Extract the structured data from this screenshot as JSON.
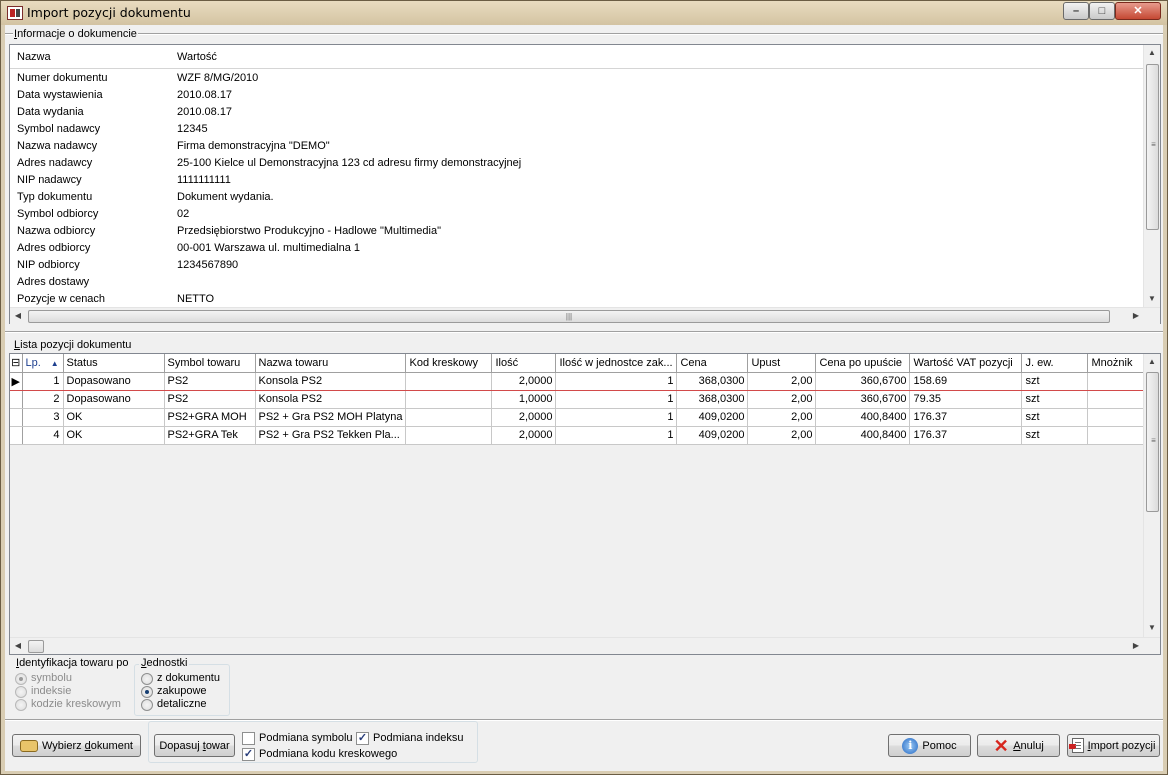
{
  "window": {
    "title": "Import pozycji dokumentu"
  },
  "info": {
    "section_label_prefix": "I",
    "section_label_rest": "nformacje o dokumencie",
    "col_name": "Nazwa",
    "col_value": "Wartość",
    "rows": [
      {
        "k": "Numer dokumentu",
        "v": "WZF 8/MG/2010"
      },
      {
        "k": "Data wystawienia",
        "v": "2010.08.17"
      },
      {
        "k": "Data wydania",
        "v": "2010.08.17"
      },
      {
        "k": "Symbol nadawcy",
        "v": "12345"
      },
      {
        "k": "Nazwa nadawcy",
        "v": "Firma demonstracyjna \"DEMO\""
      },
      {
        "k": "Adres nadawcy",
        "v": "25-100 Kielce ul Demonstracyjna 123 cd adresu firmy demonstracyjnej"
      },
      {
        "k": "NIP nadawcy",
        "v": "1111111111"
      },
      {
        "k": "Typ dokumentu",
        "v": "Dokument wydania."
      },
      {
        "k": "Symbol odbiorcy",
        "v": "02"
      },
      {
        "k": "Nazwa odbiorcy",
        "v": "Przedsiębiorstwo Produkcyjno - Hadlowe \"Multimedia\""
      },
      {
        "k": "Adres odbiorcy",
        "v": "00-001 Warszawa ul. multimedialna 1"
      },
      {
        "k": "NIP odbiorcy",
        "v": "1234567890"
      },
      {
        "k": "Adres dostawy",
        "v": ""
      },
      {
        "k": "Pozycje w cenach",
        "v": "NETTO"
      }
    ]
  },
  "positions": {
    "section_label_prefix": "L",
    "section_label_rest": "ista pozycji dokumentu",
    "columns": [
      "Lp.",
      "Status",
      "Symbol towaru",
      "Nazwa towaru",
      "Kod kreskowy",
      "Ilość",
      "Ilość w jednostce zak...",
      "Cena",
      "Upust",
      "Cena po upuście",
      "Wartość VAT pozycji",
      "J. ew.",
      "Mnożnik"
    ],
    "rows": [
      {
        "lp": "1",
        "status": "Dopasowano",
        "symbol": "PS2",
        "nazwa": "Konsola PS2",
        "kod": "",
        "ilosc": "2,0000",
        "ilosc_jz": "1",
        "cena": "368,0300",
        "upust": "2,00",
        "cena_po": "360,6700",
        "vat": "158.69",
        "jew": "szt",
        "mnoznik": ""
      },
      {
        "lp": "2",
        "status": "Dopasowano",
        "symbol": "PS2",
        "nazwa": "Konsola PS2",
        "kod": "",
        "ilosc": "1,0000",
        "ilosc_jz": "1",
        "cena": "368,0300",
        "upust": "2,00",
        "cena_po": "360,6700",
        "vat": "79.35",
        "jew": "szt",
        "mnoznik": ""
      },
      {
        "lp": "3",
        "status": "OK",
        "symbol": "PS2+GRA MOH",
        "nazwa": "PS2 + Gra PS2 MOH Platyna",
        "kod": "",
        "ilosc": "2,0000",
        "ilosc_jz": "1",
        "cena": "409,0200",
        "upust": "2,00",
        "cena_po": "400,8400",
        "vat": "176.37",
        "jew": "szt",
        "mnoznik": ""
      },
      {
        "lp": "4",
        "status": "OK",
        "symbol": "PS2+GRA Tek",
        "nazwa": "PS2 + Gra PS2 Tekken Pla...",
        "kod": "",
        "ilosc": "2,0000",
        "ilosc_jz": "1",
        "cena": "409,0200",
        "upust": "2,00",
        "cena_po": "400,8400",
        "vat": "176.37",
        "jew": "szt",
        "mnoznik": ""
      }
    ]
  },
  "identification": {
    "label_prefix": "I",
    "label_rest": "dentyfikacja towaru po",
    "options": [
      "symbolu",
      "indeksie",
      "kodzie kreskowym"
    ],
    "selected": "symbolu"
  },
  "units": {
    "label_prefix": "J",
    "label_rest": "ednostki",
    "options": [
      "z dokumentu",
      "zakupowe",
      "detaliczne"
    ],
    "selected": "zakupowe"
  },
  "checks": {
    "symbol": {
      "label": "Podmiana symbolu",
      "checked": false
    },
    "index": {
      "label": "Podmiana indeksu",
      "checked": true
    },
    "barcode": {
      "label": "Podmiana kodu kreskowego",
      "checked": true
    }
  },
  "buttons": {
    "choose_doc_pre": "Wybierz ",
    "choose_doc_u": "d",
    "choose_doc_post": "okument",
    "match_pre": "Dopasuj ",
    "match_u": "t",
    "match_post": "owar",
    "help": "Pomoc",
    "cancel_u": "A",
    "cancel_post": "nuluj",
    "import_u": "I",
    "import_post": "mport pozycji"
  }
}
